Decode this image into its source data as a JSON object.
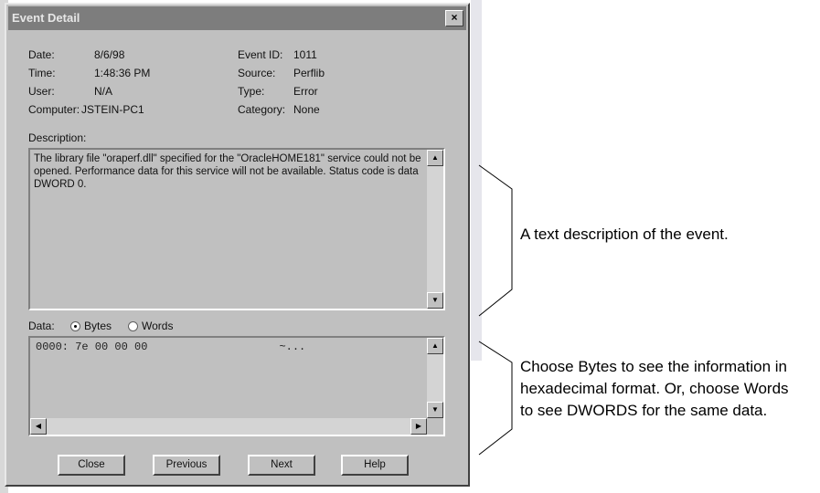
{
  "dialog": {
    "title": "Event Detail",
    "close_glyph": "×",
    "fields": {
      "date_label": "Date:",
      "date_value": "8/6/98",
      "time_label": "Time:",
      "time_value": "1:48:36 PM",
      "user_label": "User:",
      "user_value": "N/A",
      "computer_label": "Computer:",
      "computer_value": "JSTEIN-PC1",
      "event_id_label": "Event ID:",
      "event_id_value": "1011",
      "source_label": "Source:",
      "source_value": "Perflib",
      "type_label": "Type:",
      "type_value": "Error",
      "category_label": "Category:",
      "category_value": "None"
    },
    "description_label": "Description:",
    "description_text": "The library file \"oraperf.dll\" specified for the \"OracleHOME181\" service could not be opened. Performance data for this service will not be available. Status code is data DWORD 0.",
    "data_label": "Data:",
    "radio_bytes": "Bytes",
    "radio_words": "Words",
    "selected_format": "Bytes",
    "hex_line": "0000: 7e 00 00 00                    ~...",
    "buttons": {
      "close": "Close",
      "previous": "Previous",
      "next": "Next",
      "help": "Help"
    },
    "scroll_up": "▲",
    "scroll_down": "▼",
    "scroll_left": "◀",
    "scroll_right": "▶"
  },
  "annotations": {
    "description_callout": "A text description of the event.",
    "data_callout": "Choose Bytes to see the information in hexadecimal format. Or, choose Words to see DWORDS for the same data."
  }
}
